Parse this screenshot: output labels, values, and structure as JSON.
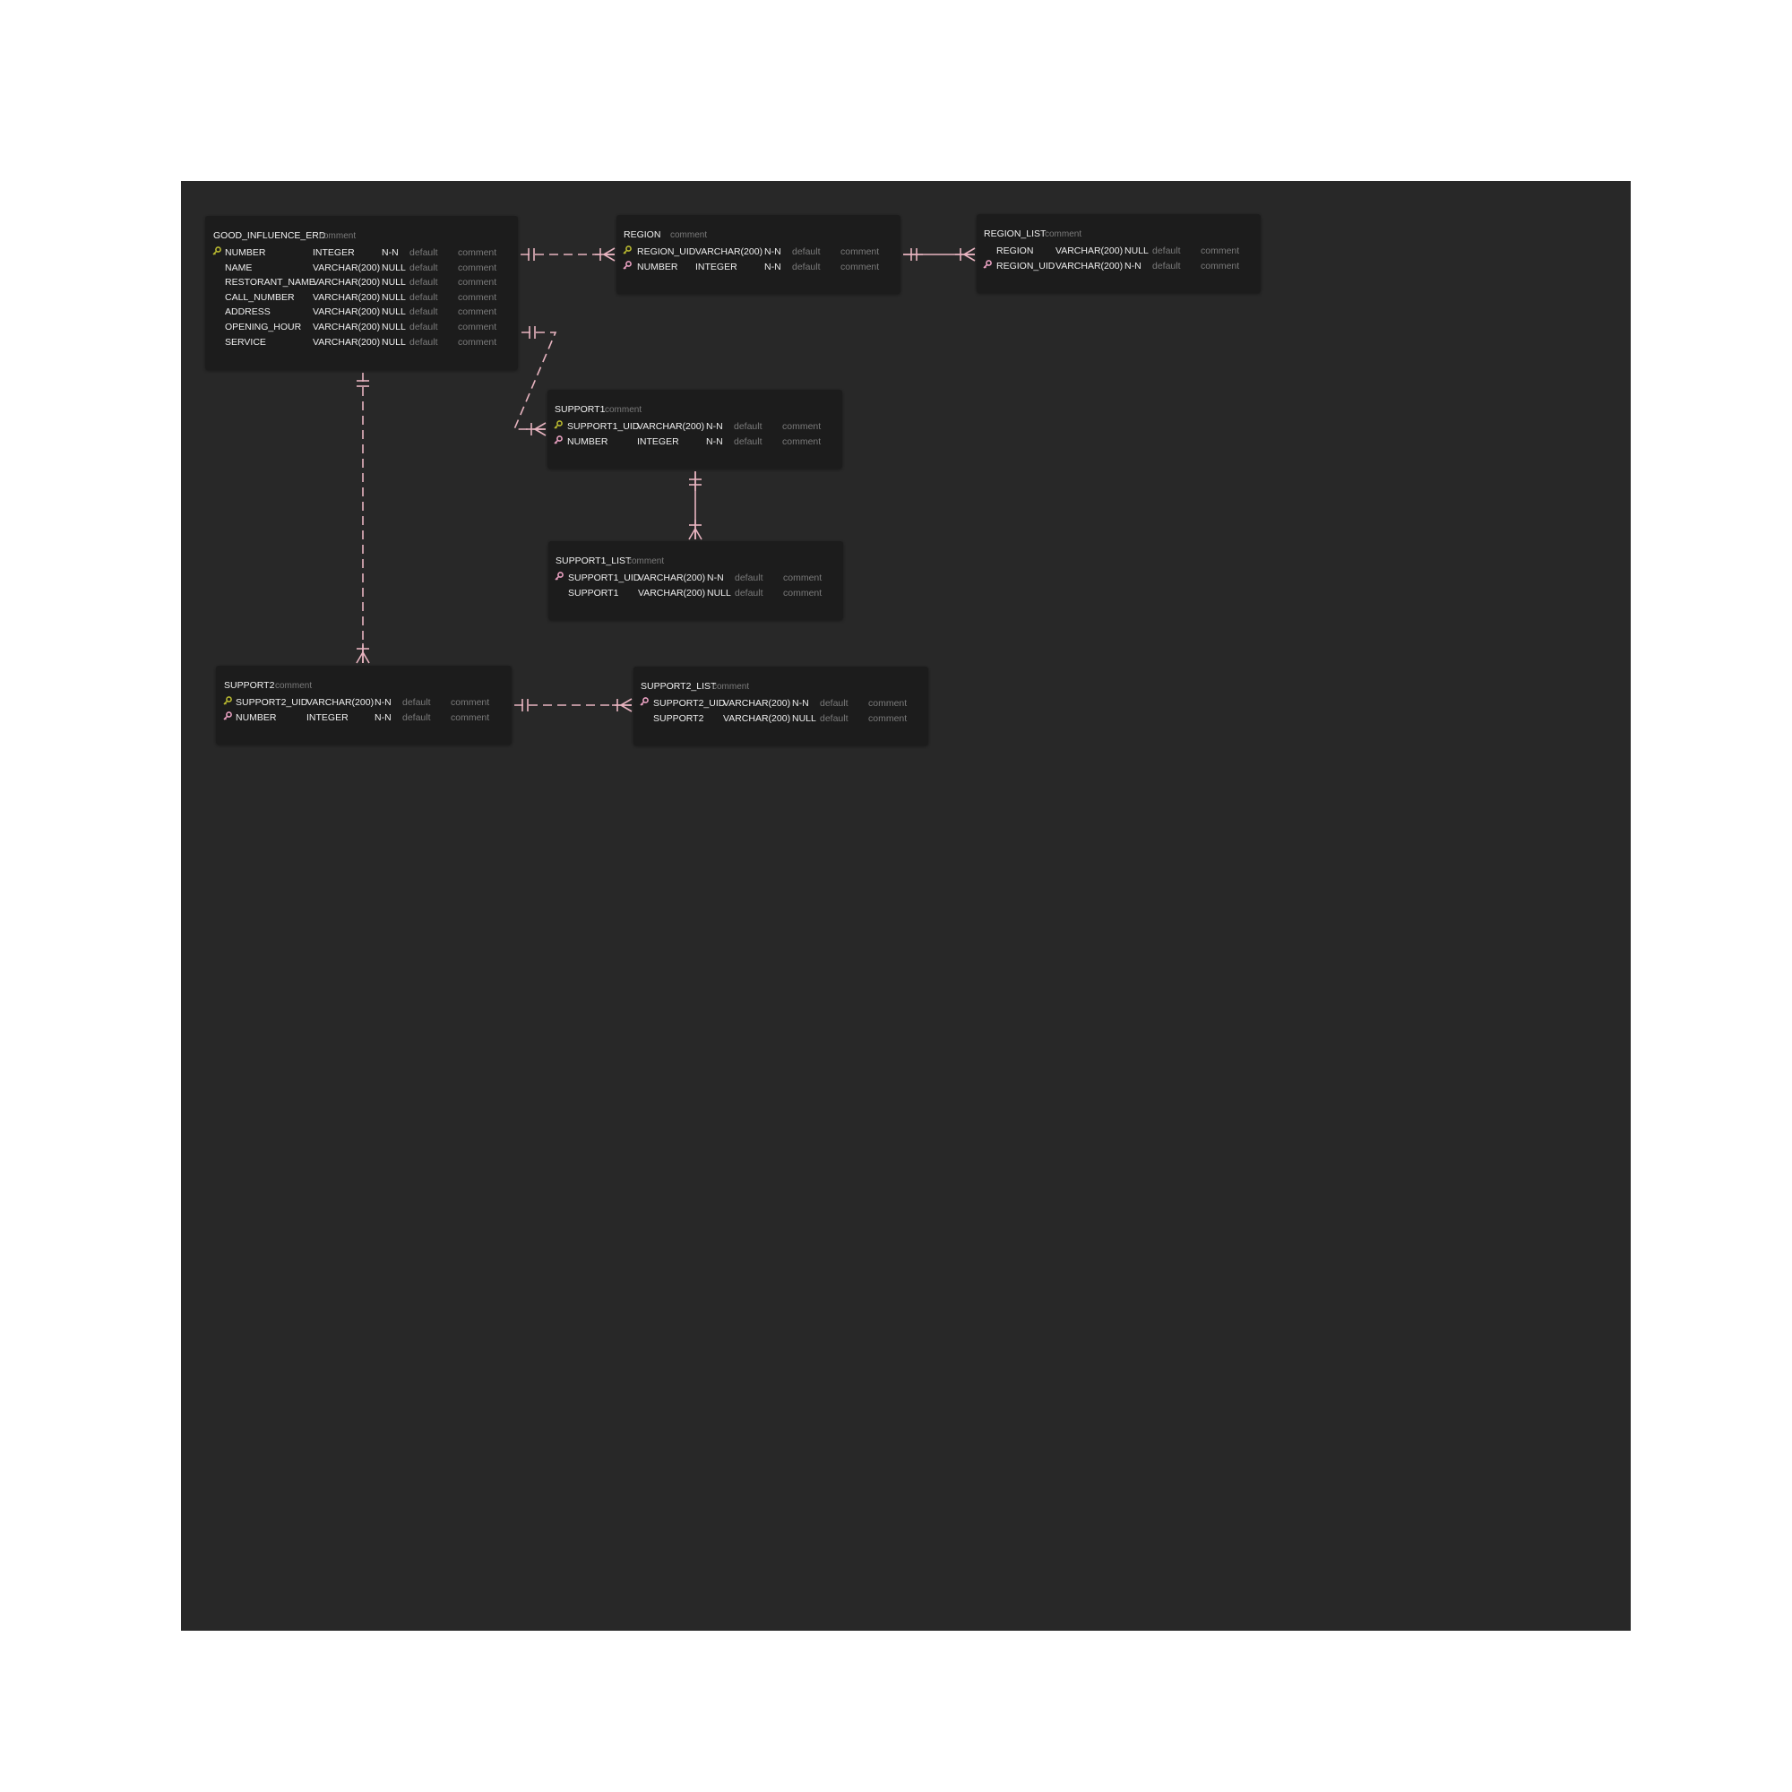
{
  "colors": {
    "canvas": "#282828",
    "table_bg": "#1c1c1c",
    "relation_line": "#e8b4c0",
    "primary_key": "#b8b830",
    "foreign_key": "#e8a0c0"
  },
  "tables": [
    {
      "name": "GOOD_INFLUENCE_ERD",
      "comment": "comment",
      "columns": [
        {
          "key": "pk",
          "name": "NUMBER",
          "type": "INTEGER",
          "null": "N-N",
          "default": "default",
          "comment": "comment"
        },
        {
          "key": "",
          "name": "NAME",
          "type": "VARCHAR(200)",
          "null": "NULL",
          "default": "default",
          "comment": "comment"
        },
        {
          "key": "",
          "name": "RESTORANT_NAME",
          "type": "VARCHAR(200)",
          "null": "NULL",
          "default": "default",
          "comment": "comment"
        },
        {
          "key": "",
          "name": "CALL_NUMBER",
          "type": "VARCHAR(200)",
          "null": "NULL",
          "default": "default",
          "comment": "comment"
        },
        {
          "key": "",
          "name": "ADDRESS",
          "type": "VARCHAR(200)",
          "null": "NULL",
          "default": "default",
          "comment": "comment"
        },
        {
          "key": "",
          "name": "OPENING_HOUR",
          "type": "VARCHAR(200)",
          "null": "NULL",
          "default": "default",
          "comment": "comment"
        },
        {
          "key": "",
          "name": "SERVICE",
          "type": "VARCHAR(200)",
          "null": "NULL",
          "default": "default",
          "comment": "comment"
        }
      ]
    },
    {
      "name": "REGION",
      "comment": "comment",
      "columns": [
        {
          "key": "pk",
          "name": "REGION_UID",
          "type": "VARCHAR(200)",
          "null": "N-N",
          "default": "default",
          "comment": "comment"
        },
        {
          "key": "fk",
          "name": "NUMBER",
          "type": "INTEGER",
          "null": "N-N",
          "default": "default",
          "comment": "comment"
        }
      ]
    },
    {
      "name": "REGION_LIST",
      "comment": "comment",
      "columns": [
        {
          "key": "",
          "name": "REGION",
          "type": "VARCHAR(200)",
          "null": "NULL",
          "default": "default",
          "comment": "comment"
        },
        {
          "key": "fk",
          "name": "REGION_UID",
          "type": "VARCHAR(200)",
          "null": "N-N",
          "default": "default",
          "comment": "comment"
        }
      ]
    },
    {
      "name": "SUPPORT1",
      "comment": "comment",
      "columns": [
        {
          "key": "pk",
          "name": "SUPPORT1_UID",
          "type": "VARCHAR(200)",
          "null": "N-N",
          "default": "default",
          "comment": "comment"
        },
        {
          "key": "fk",
          "name": "NUMBER",
          "type": "INTEGER",
          "null": "N-N",
          "default": "default",
          "comment": "comment"
        }
      ]
    },
    {
      "name": "SUPPORT1_LIST",
      "comment": "comment",
      "columns": [
        {
          "key": "fk",
          "name": "SUPPORT1_UID",
          "type": "VARCHAR(200)",
          "null": "N-N",
          "default": "default",
          "comment": "comment"
        },
        {
          "key": "",
          "name": "SUPPORT1",
          "type": "VARCHAR(200)",
          "null": "NULL",
          "default": "default",
          "comment": "comment"
        }
      ]
    },
    {
      "name": "SUPPORT2",
      "comment": "comment",
      "columns": [
        {
          "key": "pk",
          "name": "SUPPORT2_UID",
          "type": "VARCHAR(200)",
          "null": "N-N",
          "default": "default",
          "comment": "comment"
        },
        {
          "key": "fk",
          "name": "NUMBER",
          "type": "INTEGER",
          "null": "N-N",
          "default": "default",
          "comment": "comment"
        }
      ]
    },
    {
      "name": "SUPPORT2_LIST",
      "comment": "comment",
      "columns": [
        {
          "key": "fk",
          "name": "SUPPORT2_UID",
          "type": "VARCHAR(200)",
          "null": "N-N",
          "default": "default",
          "comment": "comment"
        },
        {
          "key": "",
          "name": "SUPPORT2",
          "type": "VARCHAR(200)",
          "null": "NULL",
          "default": "default",
          "comment": "comment"
        }
      ]
    }
  ],
  "relations": [
    {
      "from": "GOOD_INFLUENCE_ERD",
      "to": "REGION",
      "cardinality": "one-to-many",
      "identifying": false
    },
    {
      "from": "REGION",
      "to": "REGION_LIST",
      "cardinality": "one-to-many",
      "identifying": true
    },
    {
      "from": "GOOD_INFLUENCE_ERD",
      "to": "SUPPORT1",
      "cardinality": "one-to-many",
      "identifying": false
    },
    {
      "from": "SUPPORT1",
      "to": "SUPPORT1_LIST",
      "cardinality": "one-to-many",
      "identifying": true
    },
    {
      "from": "GOOD_INFLUENCE_ERD",
      "to": "SUPPORT2",
      "cardinality": "one-to-many",
      "identifying": false
    },
    {
      "from": "SUPPORT2",
      "to": "SUPPORT2_LIST",
      "cardinality": "one-to-many",
      "identifying": false
    }
  ]
}
